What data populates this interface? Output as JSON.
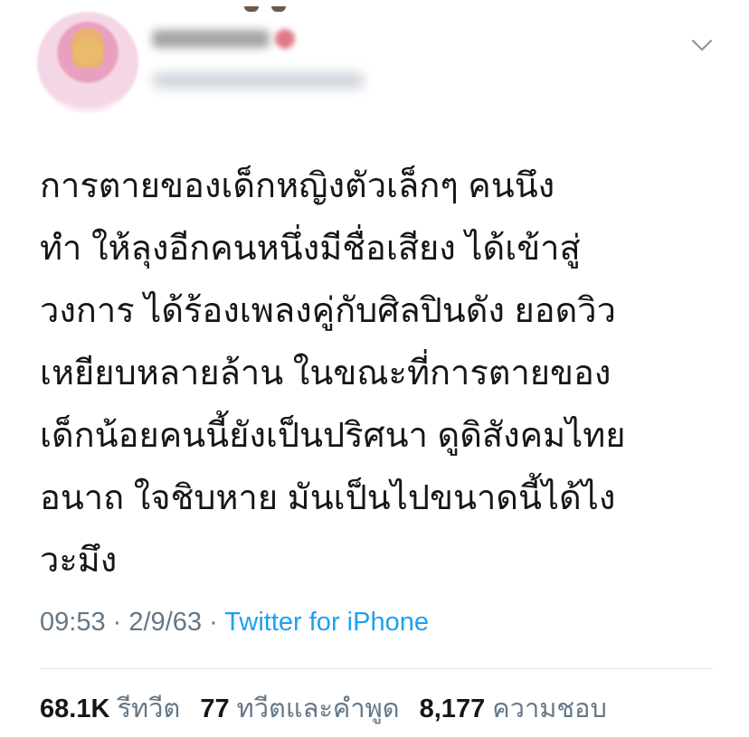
{
  "tweet": {
    "lines": [
      "การตายของเด็กหญิงตัวเล็กๆ คนนึง",
      "ทำ ให้ลุงอีกคนหนึ่งมีชื่อเสียง ได้เข้าสู่",
      "วงการ ได้ร้องเพลงคู่กับศิลปินดัง ยอดวิว",
      "เหยียบหลายล้าน  ในขณะที่การตายของ",
      "เด็กน้อยคนนี้ยังเป็นปริศนา ดูดิสังคมไทย",
      "อนาถ ใจชิบหาย มันเป็นไปขนาดนี้ได้ไง",
      "วะมึง"
    ],
    "time": "09:53",
    "date": "2/9/63",
    "separator": "·",
    "source": "Twitter for iPhone"
  },
  "stats": {
    "retweets_count": "68.1K",
    "retweets_label": "รีทวีต",
    "quotes_count": "77",
    "quotes_label": "ทวีตและคำพูด",
    "likes_count": "8,177",
    "likes_label": "ความชอบ"
  },
  "icons": {
    "menu": "chevron-down-icon"
  },
  "colors": {
    "text": "#14171a",
    "secondary": "#657786",
    "link": "#1da1f2",
    "divider": "#e1e8ed"
  }
}
